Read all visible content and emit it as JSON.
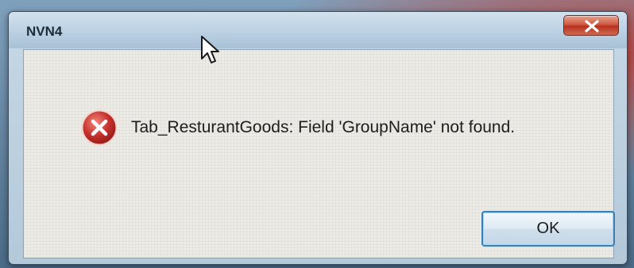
{
  "window": {
    "title": "NVN4"
  },
  "dialog": {
    "icon": "error-icon",
    "message": "Tab_ResturantGoods: Field 'GroupName' not found.",
    "ok_label": "OK",
    "close_icon": "close-icon"
  },
  "colors": {
    "close_button": "#cf5a42",
    "error_icon": "#c8322d",
    "ok_button_border": "#3c7fb1"
  }
}
